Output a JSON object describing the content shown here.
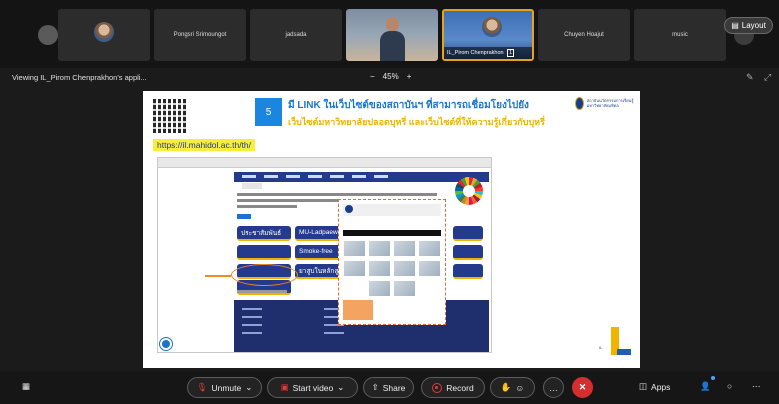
{
  "participants": {
    "tiles": [
      {
        "name": "",
        "type": "avatar"
      },
      {
        "name": "Pongsri Srimoungot",
        "type": "name"
      },
      {
        "name": "jadsada",
        "type": "name"
      },
      {
        "name": "",
        "type": "video"
      },
      {
        "name": "IL_Pirom Chenprakhon",
        "type": "active",
        "badge": "1"
      },
      {
        "name": "Chuyen Hoajut",
        "type": "name"
      },
      {
        "name": "music",
        "type": "name"
      }
    ],
    "layout_label": "Layout"
  },
  "viewbar": {
    "viewing_text": "Viewing IL_Pirom Chenprakhon's appli...",
    "zoom_minus": "−",
    "zoom_value": "45%",
    "zoom_plus": "+"
  },
  "slide": {
    "number": "5",
    "title_line1": "มี LINK ในเว็บไซต์ของสถาบันฯ ที่สามารถเชื่อมโยงไปยัง",
    "title_line2": "เว็บไซต์มหาวิทยาลัยปลอดบุหรี่ และเว็บไซต์ที่ให้ความรู้เกี่ยวกับบุหรี่",
    "url": "https://il.mahidol.ac.th/th/",
    "logo_text": "สถาบันนวัตกรรมการเรียนรู้ มหาวิทยาลัยมหิดล",
    "web_buttons": [
      "ประชาสัมพันธ์",
      "MU-Ladpaew",
      "",
      "",
      "",
      "",
      "ยาสูบในหลักสูตร",
      "",
      "",
      "Smoke-free",
      "",
      ""
    ],
    "il_logo_text": "IL"
  },
  "toolbar": {
    "unmute": "Unmute",
    "start_video": "Start video",
    "share": "Share",
    "record": "Record",
    "apps": "Apps"
  },
  "colors": {
    "accent_yellow": "#e6a316",
    "slide_blue": "#1b86e0",
    "record_red": "#e53935",
    "end_red": "#d32f2f"
  }
}
